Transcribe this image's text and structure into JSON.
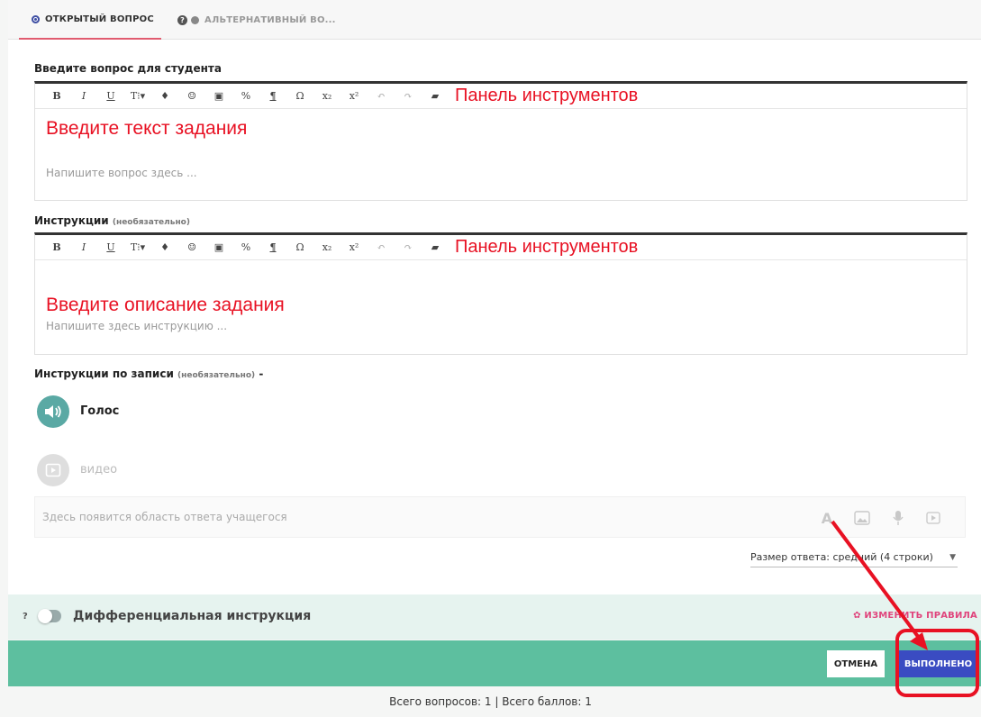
{
  "tabs": [
    {
      "label": "ОТКРЫТЫЙ ВОПРОС"
    },
    {
      "label": "АЛЬТЕРНАТИВНЫЙ ВО..."
    }
  ],
  "question": {
    "label": "Введите вопрос для студента",
    "toolbar_note": "Панель инструментов",
    "annotation": "Введите текст задания",
    "placeholder": "Напишите вопрос здесь ..."
  },
  "instructions": {
    "label": "Инструкции",
    "optional": "(необязательно)",
    "toolbar_note": "Панель инструментов",
    "annotation": "Введите описание задания",
    "placeholder": "Напишите здесь инструкцию ..."
  },
  "toolbar_buttons": [
    "B",
    "I",
    "U",
    "T⁝▾",
    "♦",
    "☺",
    "▣",
    "%",
    "¶",
    "Ω",
    "x₂",
    "x²",
    "↶",
    "↷",
    "▰"
  ],
  "recording": {
    "label": "Инструкции по записи",
    "optional": "(необязательно)",
    "dash": "-",
    "voice": "Голос",
    "video": "видео"
  },
  "answer": {
    "placeholder": "Здесь появится область ответа учащегося",
    "size_label": "Размер ответа: средний (4 строки)"
  },
  "differential": {
    "question_mark": "?",
    "title": "Дифференциальная инструкция",
    "rules_label": "ИЗМЕНИТЬ ПРАВИЛА"
  },
  "footer": {
    "cancel": "ОТМЕНА",
    "done": "ВЫПОЛНЕНО"
  },
  "status": {
    "text": "Всего вопросов: 1 | Всего баллов: 1"
  },
  "colors": {
    "accent_green": "#5dbf9f",
    "done_blue": "#3a4cc2",
    "annotation_red": "#e81123",
    "rules_pink": "#e0447c"
  }
}
